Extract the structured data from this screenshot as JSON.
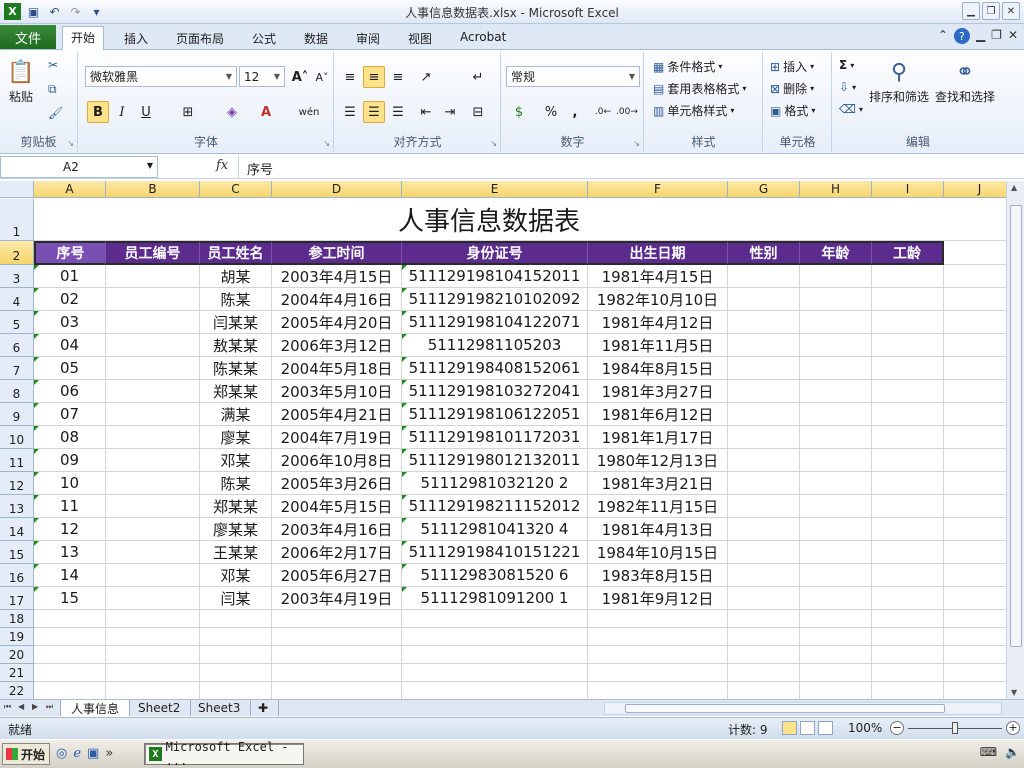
{
  "window": {
    "title": "人事信息数据表.xlsx - Microsoft Excel"
  },
  "ribbon_tabs": {
    "file": "文件",
    "items": [
      "开始",
      "插入",
      "页面布局",
      "公式",
      "数据",
      "审阅",
      "视图",
      "Acrobat"
    ],
    "active_index": 0
  },
  "ribbon": {
    "clipboard": {
      "label": "剪贴板",
      "paste": "粘贴"
    },
    "font": {
      "label": "字体",
      "name": "微软雅黑",
      "size": "12",
      "bold": "B",
      "italic": "I",
      "underline": "U",
      "grow": "A",
      "shrink": "A",
      "font_color": "A",
      "phonetic": "wén"
    },
    "alignment": {
      "label": "对齐方式"
    },
    "number": {
      "label": "数字",
      "format": "常规",
      "percent": "%",
      "comma": ","
    },
    "styles": {
      "label": "样式",
      "conditional": "条件格式",
      "table_format": "套用表格格式",
      "cell_styles": "单元格样式"
    },
    "cells": {
      "label": "单元格",
      "insert": "插入",
      "delete": "删除",
      "format": "格式"
    },
    "editing": {
      "label": "编辑",
      "sort_filter": "排序和筛选",
      "find_select": "查找和选择",
      "sum": "Σ"
    }
  },
  "formula_bar": {
    "name_box": "A2",
    "fx": "fx",
    "content": "序号"
  },
  "sheet": {
    "columns": [
      "A",
      "B",
      "C",
      "D",
      "E",
      "F",
      "G",
      "H",
      "I",
      "J"
    ],
    "row_numbers": [
      "1",
      "2",
      "3",
      "4",
      "5",
      "6",
      "7",
      "8",
      "9",
      "10",
      "11",
      "12",
      "13",
      "14",
      "15",
      "16",
      "17",
      "18",
      "19",
      "20",
      "21",
      "22"
    ],
    "title": "人事信息数据表",
    "headers": [
      "序号",
      "员工编号",
      "员工姓名",
      "参工时间",
      "身份证号",
      "出生日期",
      "性别",
      "年龄",
      "工龄"
    ],
    "rows": [
      [
        "01",
        "",
        "胡某",
        "2003年4月15日",
        "511129198104152011",
        "1981年4月15日"
      ],
      [
        "02",
        "",
        "陈某",
        "2004年4月16日",
        "511129198210102092",
        "1982年10月10日"
      ],
      [
        "03",
        "",
        "闫某某",
        "2005年4月20日",
        "511129198104122071",
        "1981年4月12日"
      ],
      [
        "04",
        "",
        "敖某某",
        "2006年3月12日",
        "51112981105203",
        "1981年11月5日"
      ],
      [
        "05",
        "",
        "陈某某",
        "2004年5月18日",
        "511129198408152061",
        "1984年8月15日"
      ],
      [
        "06",
        "",
        "郑某某",
        "2003年5月10日",
        "511129198103272041",
        "1981年3月27日"
      ],
      [
        "07",
        "",
        "满某",
        "2005年4月21日",
        "511129198106122051",
        "1981年6月12日"
      ],
      [
        "08",
        "",
        "廖某",
        "2004年7月19日",
        "511129198101172031",
        "1981年1月17日"
      ],
      [
        "09",
        "",
        "邓某",
        "2006年10月8日",
        "511129198012132011",
        "1980年12月13日"
      ],
      [
        "10",
        "",
        "陈某",
        "2005年3月26日",
        "51112981032120 2",
        "1981年3月21日"
      ],
      [
        "11",
        "",
        "郑某某",
        "2004年5月15日",
        "511129198211152012",
        "1982年11月15日"
      ],
      [
        "12",
        "",
        "廖某某",
        "2003年4月16日",
        "51112981041320 4",
        "1981年4月13日"
      ],
      [
        "13",
        "",
        "王某某",
        "2006年2月17日",
        "511129198410151221",
        "1984年10月15日"
      ],
      [
        "14",
        "",
        "邓某",
        "2005年6月27日",
        "51112983081520 6",
        "1983年8月15日"
      ],
      [
        "15",
        "",
        "闫某",
        "2003年4月19日",
        "51112981091200 1",
        "1981年9月12日"
      ]
    ]
  },
  "sheet_tabs": [
    "人事信息",
    "Sheet2",
    "Sheet3"
  ],
  "status": {
    "ready": "就绪",
    "count": "计数: 9",
    "zoom": "100%",
    "zoom_fraction": 0.5
  },
  "taskbar": {
    "start": "开始",
    "task": "Microsoft Excel - ..."
  }
}
